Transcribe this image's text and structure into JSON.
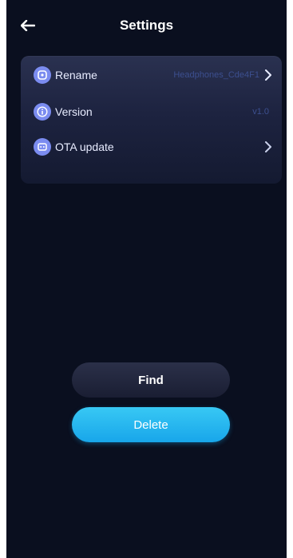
{
  "header": {
    "title": "Settings",
    "back_icon": "back-arrow-icon"
  },
  "settings": {
    "rows": [
      {
        "label": "Rename",
        "value": "Headphones_Cde4F1",
        "icon": "rename-icon",
        "has_chevron": true
      },
      {
        "label": "Version",
        "value": "v1.0",
        "icon": "info-icon",
        "has_chevron": false
      },
      {
        "label": "OTA update",
        "value": "",
        "icon": "ota-update-icon",
        "has_chevron": true
      }
    ]
  },
  "actions": {
    "find_label": "Find",
    "delete_label": "Delete"
  },
  "colors": {
    "background": "#0a0f1f",
    "accent": "#18a6ea",
    "icon_bg": "#7b8cf0"
  }
}
